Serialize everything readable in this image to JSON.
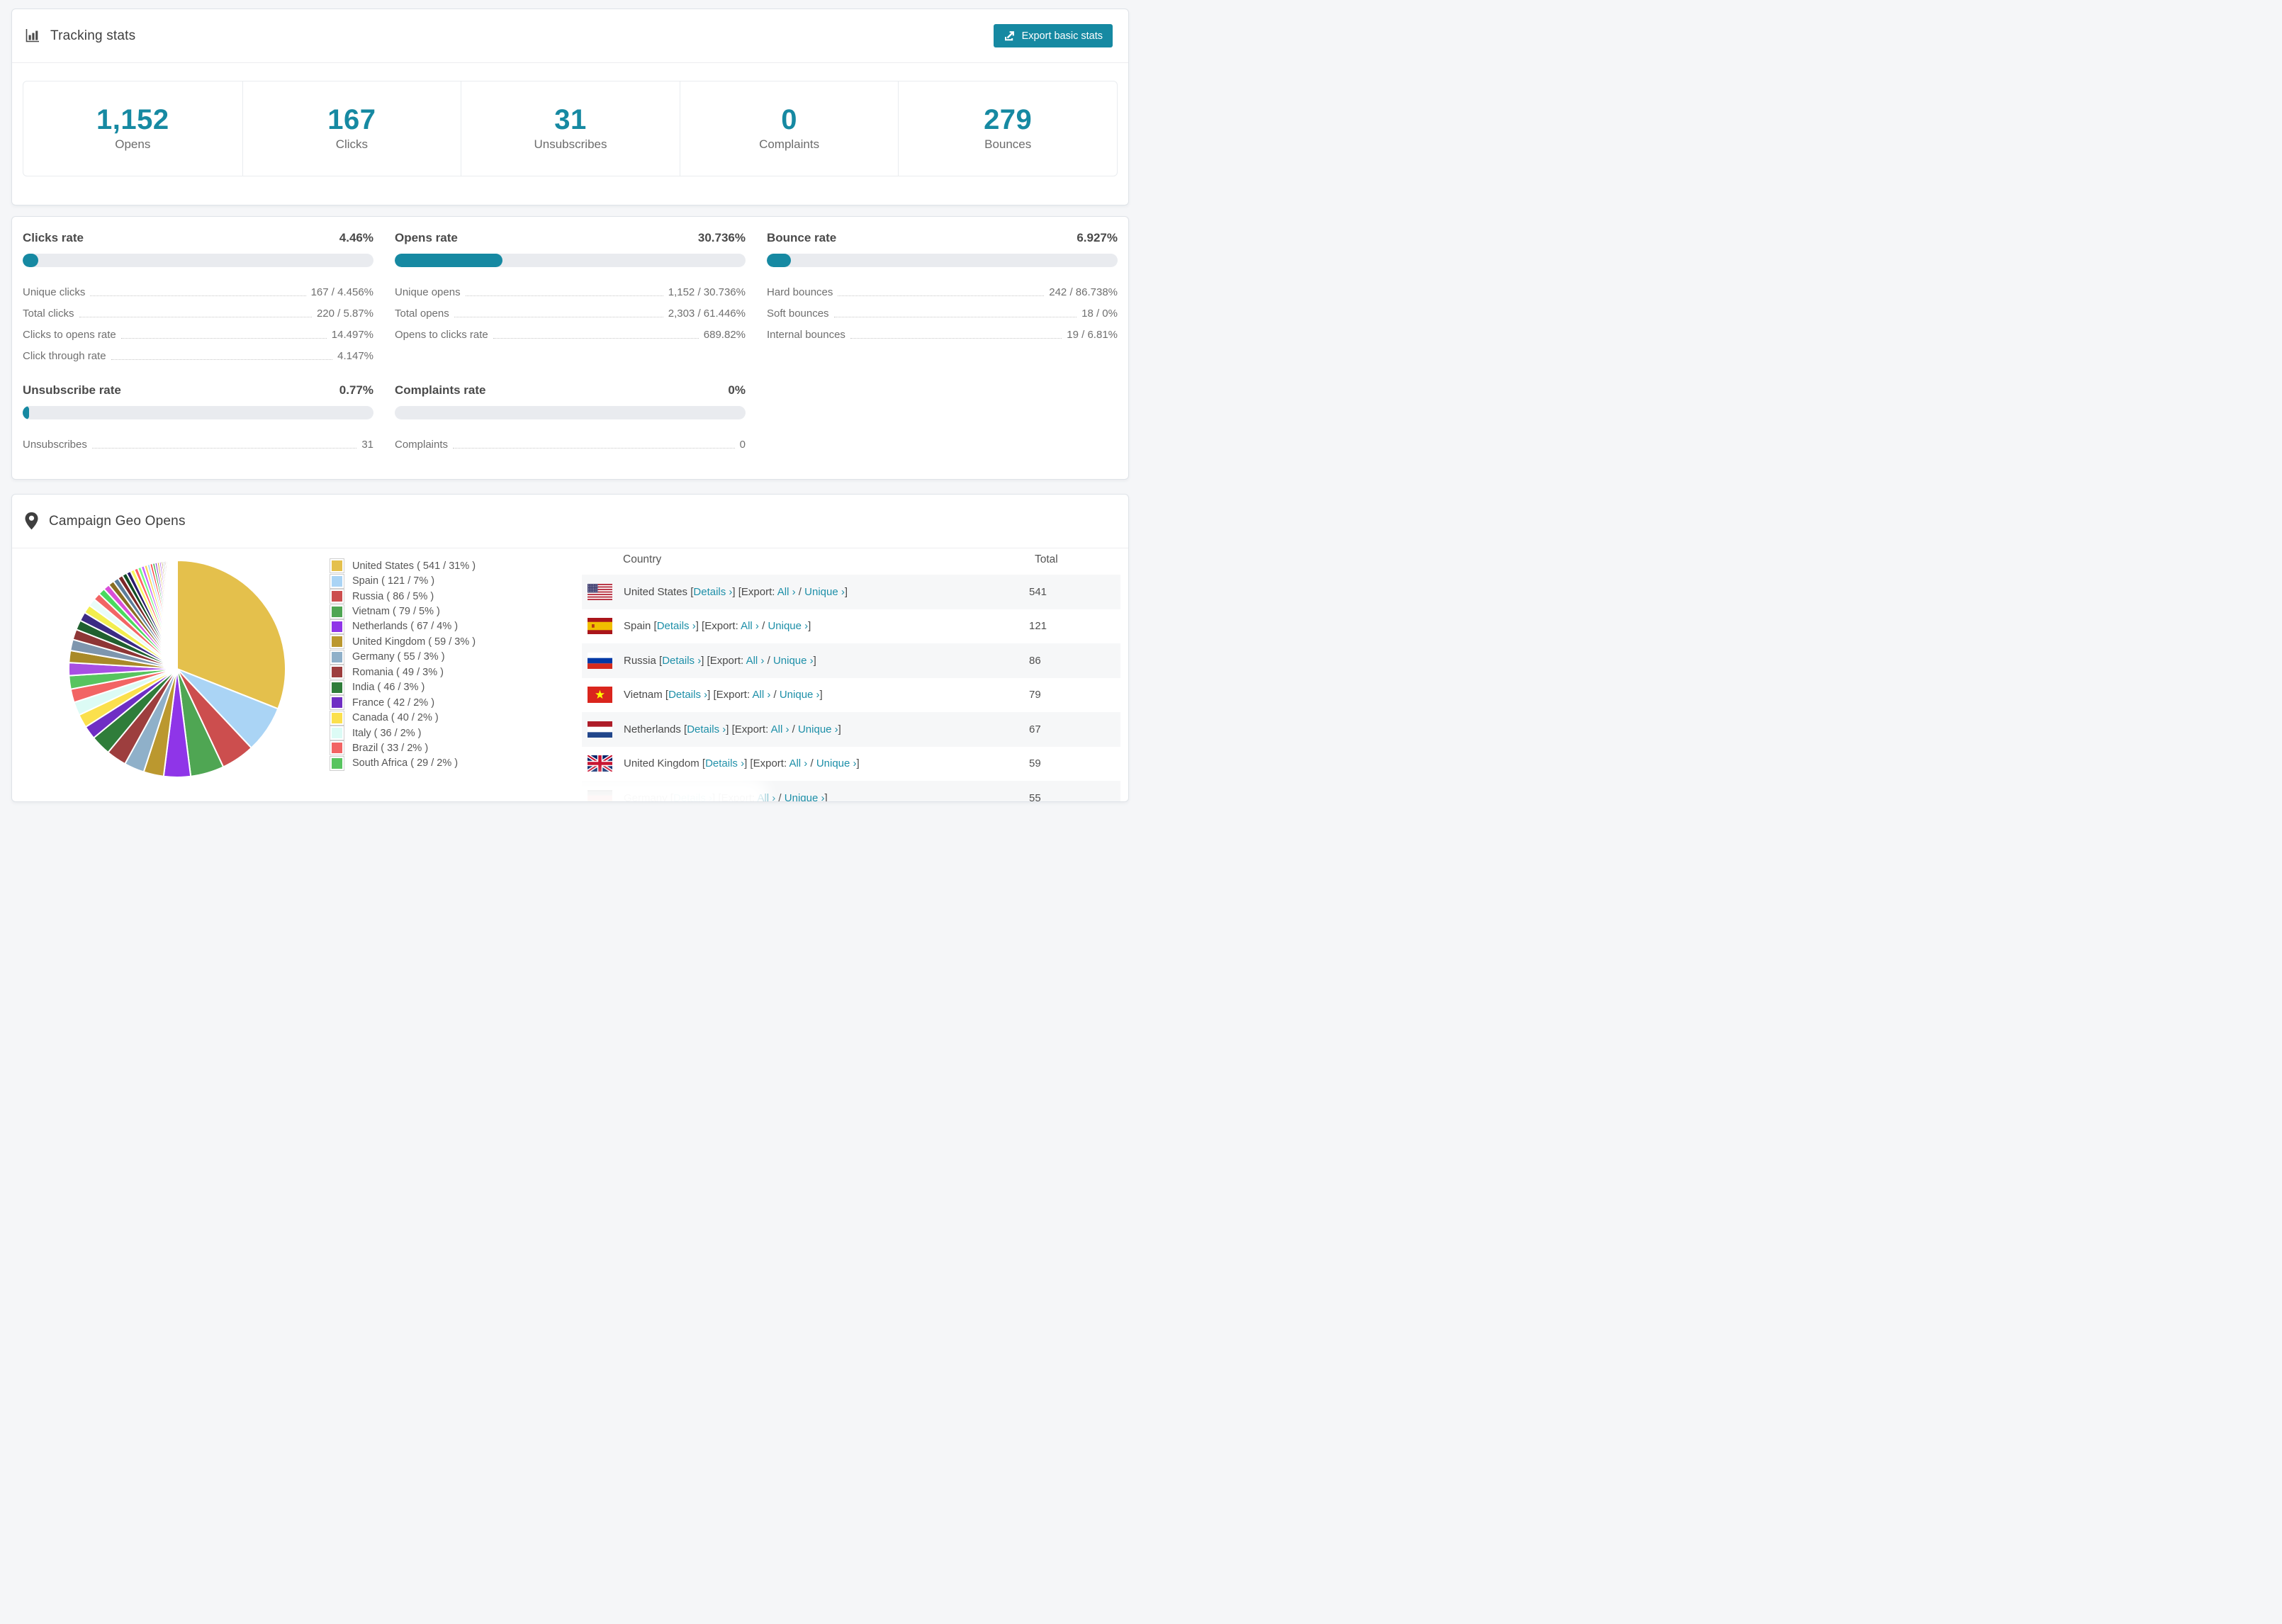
{
  "theme": {
    "accent": "#1689a2",
    "link": "#1d8fa8",
    "page_bg": "#f5f6f8",
    "progress_track": "#e9ebef",
    "stripe_row": "#f6f7f8"
  },
  "tracking": {
    "title": "Tracking stats",
    "export_button": "Export basic stats",
    "stats": [
      {
        "value": "1,152",
        "label": "Opens"
      },
      {
        "value": "167",
        "label": "Clicks"
      },
      {
        "value": "31",
        "label": "Unsubscribes"
      },
      {
        "value": "0",
        "label": "Complaints"
      },
      {
        "value": "279",
        "label": "Bounces"
      }
    ]
  },
  "rates": {
    "blocks": [
      {
        "title": "Clicks rate",
        "value": "4.46%",
        "pct": 4.46,
        "rows": [
          {
            "label": "Unique clicks",
            "value": "167 / 4.456%"
          },
          {
            "label": "Total clicks",
            "value": "220 / 5.87%"
          },
          {
            "label": "Clicks to opens rate",
            "value": "14.497%"
          },
          {
            "label": "Click through rate",
            "value": "4.147%"
          }
        ]
      },
      {
        "title": "Opens rate",
        "value": "30.736%",
        "pct": 30.736,
        "rows": [
          {
            "label": "Unique opens",
            "value": "1,152 / 30.736%"
          },
          {
            "label": "Total opens",
            "value": "2,303 / 61.446%"
          },
          {
            "label": "Opens to clicks rate",
            "value": "689.82%"
          }
        ]
      },
      {
        "title": "Bounce rate",
        "value": "6.927%",
        "pct": 6.927,
        "rows": [
          {
            "label": "Hard bounces",
            "value": "242 / 86.738%"
          },
          {
            "label": "Soft bounces",
            "value": "18 / 0%"
          },
          {
            "label": "Internal bounces",
            "value": "19 / 6.81%"
          }
        ]
      },
      {
        "title": "Unsubscribe rate",
        "value": "0.77%",
        "pct": 0.77,
        "rows": [
          {
            "label": "Unsubscribes",
            "value": "31"
          }
        ]
      },
      {
        "title": "Complaints rate",
        "value": "0%",
        "pct": 0,
        "rows": [
          {
            "label": "Complaints",
            "value": "0"
          }
        ]
      }
    ]
  },
  "geo": {
    "title": "Campaign Geo Opens",
    "legend": [
      "United States ( 541 / 31% )",
      "Spain ( 121 / 7% )",
      "Russia ( 86 / 5% )",
      "Vietnam ( 79 / 5% )",
      "Netherlands ( 67 / 4% )",
      "United Kingdom ( 59 / 3% )",
      "Germany ( 55 / 3% )",
      "Romania ( 49 / 3% )",
      "India ( 46 / 3% )",
      "France ( 42 / 2% )",
      "Canada ( 40 / 2% )",
      "Italy ( 36 / 2% )",
      "Brazil ( 33 / 2% )",
      "South Africa ( 29 / 2% )"
    ],
    "table": {
      "columns": [
        "Country",
        "Total"
      ],
      "links": {
        "open": "[",
        "close": "]",
        "details": "Details ›",
        "export_prefix": "Export:",
        "all": "All ›",
        "separator": "/",
        "unique": "Unique ›"
      },
      "rows": [
        {
          "flag": "us",
          "country": "United States",
          "total": "541"
        },
        {
          "flag": "es",
          "country": "Spain",
          "total": "121"
        },
        {
          "flag": "ru",
          "country": "Russia",
          "total": "86"
        },
        {
          "flag": "vn",
          "country": "Vietnam",
          "total": "79"
        },
        {
          "flag": "nl",
          "country": "Netherlands",
          "total": "67"
        },
        {
          "flag": "gb",
          "country": "United Kingdom",
          "total": "59"
        },
        {
          "flag": "de",
          "country": "Germany",
          "total": "55"
        }
      ]
    }
  },
  "chart_data": {
    "type": "pie",
    "title": "Campaign Geo Opens",
    "legend_position": "right",
    "start_angle_deg": 0,
    "direction": "clockwise",
    "slices": [
      {
        "label": "United States",
        "value": 541,
        "pct": 31,
        "color": "#e4c04c"
      },
      {
        "label": "Spain",
        "value": 121,
        "pct": 7,
        "color": "#aad4f5"
      },
      {
        "label": "Russia",
        "value": 86,
        "pct": 5,
        "color": "#cc4e4e"
      },
      {
        "label": "Vietnam",
        "value": 79,
        "pct": 5,
        "color": "#4fa653"
      },
      {
        "label": "Netherlands",
        "value": 67,
        "pct": 4,
        "color": "#8f35e8"
      },
      {
        "label": "United Kingdom",
        "value": 59,
        "pct": 3,
        "color": "#bb982f"
      },
      {
        "label": "Germany",
        "value": 55,
        "pct": 3,
        "color": "#8fb0c9"
      },
      {
        "label": "Romania",
        "value": 49,
        "pct": 3,
        "color": "#9d3e3e"
      },
      {
        "label": "India",
        "value": 46,
        "pct": 3,
        "color": "#2f7d3a"
      },
      {
        "label": "France",
        "value": 42,
        "pct": 2,
        "color": "#6f2ec4"
      },
      {
        "label": "Canada",
        "value": 40,
        "pct": 2,
        "color": "#fbe04d"
      },
      {
        "label": "Italy",
        "value": 36,
        "pct": 2,
        "color": "#dcfbf5"
      },
      {
        "label": "Brazil",
        "value": 33,
        "pct": 2,
        "color": "#f26464"
      },
      {
        "label": "South Africa",
        "value": 29,
        "pct": 2,
        "color": "#57c45f"
      }
    ],
    "unlabeled_small_slices": {
      "total_pct": 26,
      "count": 40,
      "decay": 0.93,
      "palette": [
        "#a84fe3",
        "#a98a28",
        "#7e96ae",
        "#8e3636",
        "#20602f",
        "#3c2a84",
        "#f3ee4e",
        "#e9fcf8",
        "#f26464",
        "#49da5e",
        "#d94fd9",
        "#8a6d22",
        "#5c7e9a",
        "#7c2727",
        "#114d22",
        "#2c1c6a",
        "#f6fa5e",
        "#ff6262",
        "#6dff82",
        "#c45fff",
        "#ffd44e",
        "#abdaff",
        "#fd3b3b",
        "#36ab47",
        "#8c35cf",
        "#cfae25"
      ]
    }
  }
}
